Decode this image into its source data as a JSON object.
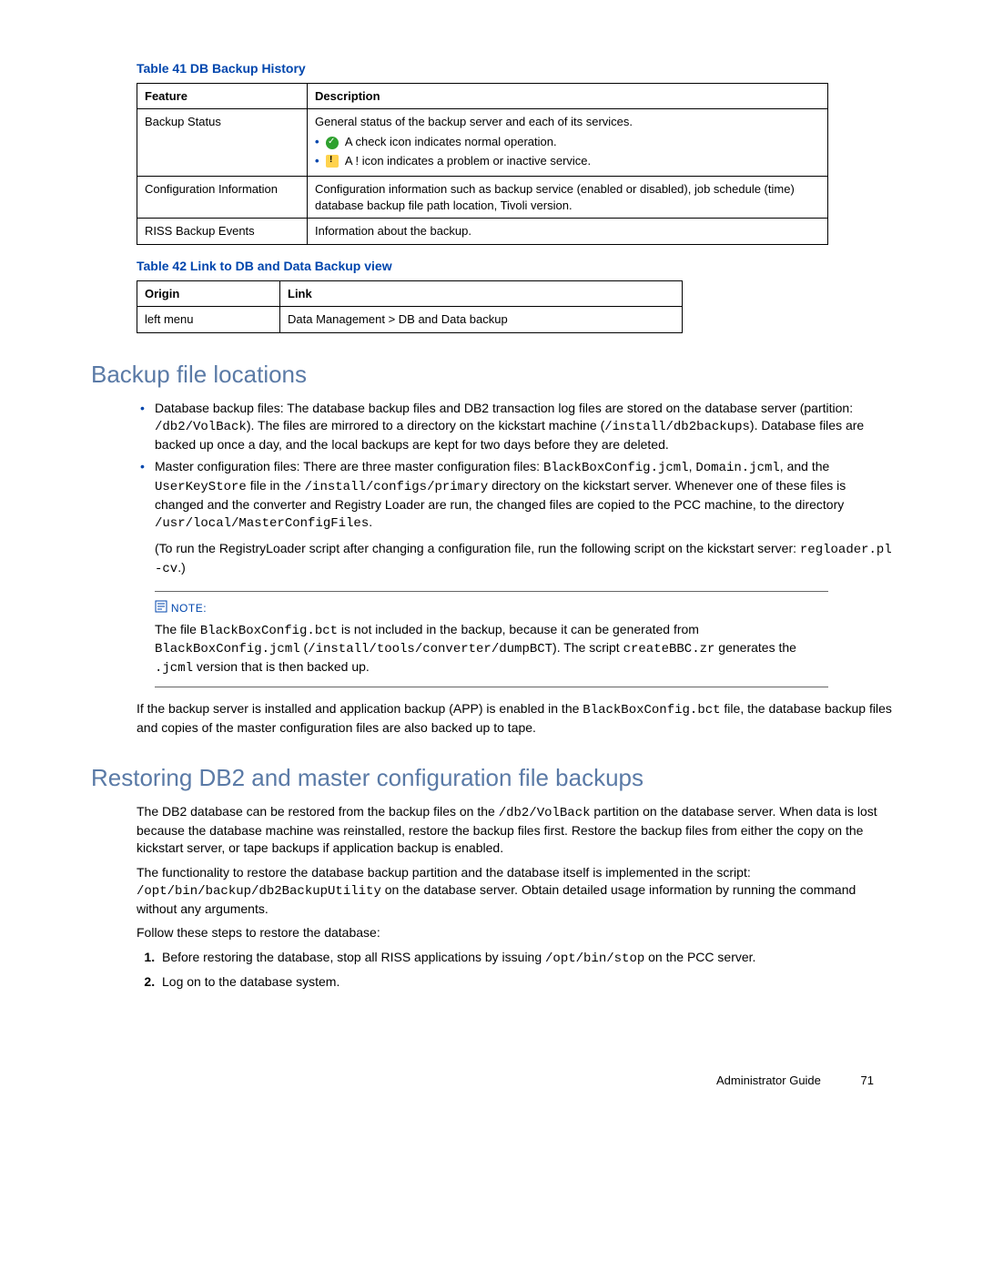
{
  "table41": {
    "caption": "Table 41 DB Backup History",
    "headers": {
      "c1": "Feature",
      "c2": "Description"
    },
    "rows": [
      {
        "feature": "Backup Status",
        "desc_intro": "General status of the backup server and each of its services.",
        "bullet1": "A check icon indicates normal operation.",
        "bullet2": "A ! icon indicates a problem or inactive service."
      },
      {
        "feature": "Configuration Information",
        "desc": "Configuration information such as backup service (enabled or disabled), job schedule (time) database backup file path location, Tivoli version."
      },
      {
        "feature": "RISS Backup Events",
        "desc": "Information about the backup."
      }
    ]
  },
  "table42": {
    "caption": "Table 42 Link to DB and Data Backup view",
    "headers": {
      "c1": "Origin",
      "c2": "Link"
    },
    "row": {
      "origin": "left menu",
      "link": "Data Management > DB and Data backup"
    }
  },
  "section1": {
    "title": "Backup file locations",
    "item1": {
      "t1": "Database backup files: The database backup files and DB2 transaction log files are stored on the database server (partition: ",
      "c1": "/db2/VolBack",
      "t2": "). The files are mirrored to a directory on the kickstart machine (",
      "c2": "/install/db2backups",
      "t3": "). Database files are backed up once a day, and the local backups are kept for two days before they are deleted."
    },
    "item2": {
      "t1": "Master configuration files: There are three master configuration files: ",
      "c1": "BlackBoxConfig.jcml",
      "t2": ", ",
      "c2": "Domain.jcml",
      "t3": ", and the ",
      "c3": "UserKeyStore",
      "t4": " file in the ",
      "c4": "/install/configs/primary",
      "t5": " directory on the kickstart server. Whenever one of these files is changed and the converter and Registry Loader are run, the changed files are copied to the PCC machine, to the directory ",
      "c5": "/usr/local/MasterConfigFiles",
      "t6": ".",
      "p2a": "(To run the RegistryLoader script after changing a configuration file, run the following script on the kickstart server: ",
      "p2b": "regloader.pl -cv",
      "p2c": ".)"
    },
    "note": {
      "label": "NOTE:",
      "t1": "The file ",
      "c1": "BlackBoxConfig.bct",
      "t2": " is not included in the backup, because it can be generated from ",
      "c2": "BlackBoxConfig.jcml",
      "t3": " (",
      "c3": "/install/tools/converter/dumpBCT",
      "t4": "). The script ",
      "c4": "createBBC.zr",
      "t5": " generates the ",
      "c5": ".jcml",
      "t6": " version that is then backed up."
    },
    "after": {
      "t1": "If the backup server is installed and application backup (APP) is enabled in the ",
      "c1": "BlackBoxConfig.bct",
      "t2": " file, the database backup files and copies of the master configuration files are also backed up to tape."
    }
  },
  "section2": {
    "title": "Restoring DB2 and master configuration file backups",
    "p1": {
      "t1": "The DB2 database can be restored from the backup files on the ",
      "c1": "/db2/VolBack",
      "t2": " partition on the database server. When data is lost because the database machine was reinstalled, restore the backup files first. Restore the backup files from either the copy on the kickstart server, or tape backups if application backup is enabled."
    },
    "p2": {
      "t1": "The functionality to restore the database backup partition and the database itself is implemented in the script: ",
      "c1": "/opt/bin/backup/db2BackupUtility",
      "t2": " on the database server. Obtain detailed usage information by running the command without any arguments."
    },
    "p3": "Follow these steps to restore the database:",
    "steps": {
      "s1a": "Before restoring the database, stop all RISS applications by issuing ",
      "s1b": "/opt/bin/stop",
      "s1c": " on the PCC server.",
      "s2": "Log on to the database system."
    }
  },
  "footer": {
    "title": "Administrator Guide",
    "page": "71"
  }
}
